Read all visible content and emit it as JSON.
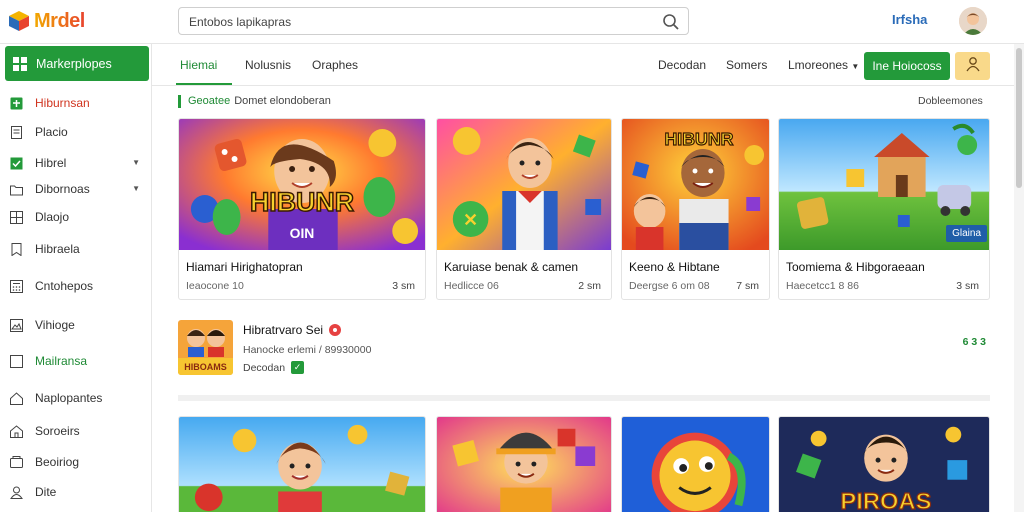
{
  "app": {
    "logo_text": "Mrdel",
    "brand_right": "Irfsha"
  },
  "search": {
    "value": "Entobos lapikapras",
    "placeholder": "Entobos lapikapras"
  },
  "sidebar": {
    "active": "Markerplopes",
    "items": [
      {
        "label": "Hiburnsan",
        "icon": "game-icon",
        "style": "red"
      },
      {
        "label": "Placio",
        "icon": "document-icon"
      },
      {
        "label": "Hibrel",
        "icon": "checkbox-icon",
        "chevron": true
      },
      {
        "label": "Dibornoas",
        "icon": "folder-icon",
        "chevron": true
      },
      {
        "label": "Dlaojo",
        "icon": "grid-icon"
      },
      {
        "label": "Hibraela",
        "icon": "bookmark-icon"
      },
      {
        "label": "Cntohepos",
        "icon": "calculator-icon"
      },
      {
        "label": "Vihioge",
        "icon": "image-icon"
      },
      {
        "label": "Mailransa",
        "icon": "square-icon",
        "style": "green"
      },
      {
        "label": "Naplopantes",
        "icon": "home-icon"
      },
      {
        "label": "Soroeirs",
        "icon": "house-icon"
      },
      {
        "label": "Beoiriog",
        "icon": "tag-icon"
      },
      {
        "label": "Dite",
        "icon": "person-icon"
      }
    ]
  },
  "tabs": [
    {
      "label": "Hiemai",
      "active": true
    },
    {
      "label": "Nolusnis"
    },
    {
      "label": "Oraphes"
    }
  ],
  "toolbar": {
    "link1": "Decodan",
    "link2": "Somers",
    "link3": "Lmoreones",
    "primary_button": "Ine Hoiocoss"
  },
  "section": {
    "title_green": "Geoatee",
    "title_rest": "Domet elondoberan",
    "more": "Dobleemones"
  },
  "cards": [
    {
      "title": "Hiamari Hirighatopran",
      "sub": "Ieaocone 10",
      "meta": "3 sm",
      "art_text": "HIBUNR",
      "art_text2": "OIN"
    },
    {
      "title": "Karuiase benak & camen",
      "sub": "Hedlicce 06",
      "meta": "2 sm"
    },
    {
      "title": "Keeno & Hibtane",
      "sub": "Deergse 6 om 08",
      "meta": "7 sm",
      "art_text": "HIBUNR"
    },
    {
      "title": "Toomiema & Hibgoraeaan",
      "sub": "Haecetcc1 8 86",
      "meta": "3 sm",
      "badge": "Glaina"
    }
  ],
  "feature": {
    "title": "Hibratrvaro Sei",
    "sub": "Hanocke erlemi / 89930000",
    "status": "Decodan",
    "right": "6 3 3",
    "thumb_text": "HIBOAMS"
  },
  "bottom_cards": [
    {
      "art": "girl-coins"
    },
    {
      "art": "worker"
    },
    {
      "art": "bird"
    },
    {
      "art_text": "PIROAS"
    }
  ],
  "colors": {
    "accent_green": "#239a3a",
    "link_blue": "#2a6bb8",
    "highlight_red": "#d0341f",
    "profile_yellow": "#f9d98a"
  }
}
